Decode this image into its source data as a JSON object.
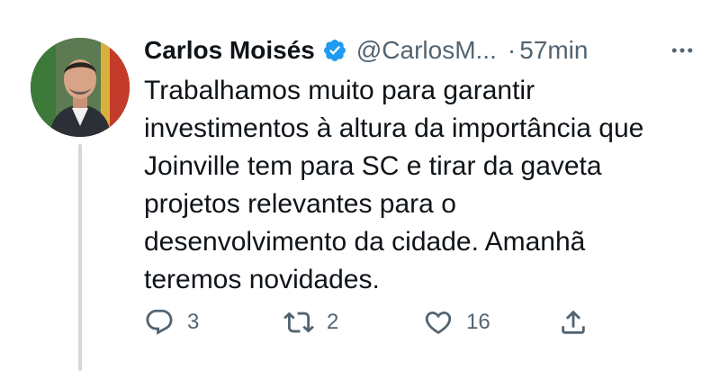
{
  "author": {
    "name": "Carlos Moisés",
    "handle": "@CarlosM...",
    "separator": "·",
    "time": "57min",
    "verified": true
  },
  "tweet": {
    "text": "Trabalhamos muito para garantir\ninvestimentos à altura da importância que\nJoinville tem para SC e tirar da gaveta\nprojetos relevantes para o\ndesenvolvimento da cidade. Amanhã\nteremos novidades."
  },
  "actions": {
    "reply_count": "3",
    "retweet_count": "2",
    "like_count": "16"
  },
  "icons": {
    "verified": "verified-badge-icon",
    "more": "more-dots-icon",
    "reply": "reply-icon",
    "retweet": "retweet-icon",
    "like": "heart-icon",
    "share": "share-icon"
  },
  "colors": {
    "text": "#0f1419",
    "secondary": "#536471",
    "verified": "#1d9bf0",
    "thread_line": "#cfd9de"
  }
}
